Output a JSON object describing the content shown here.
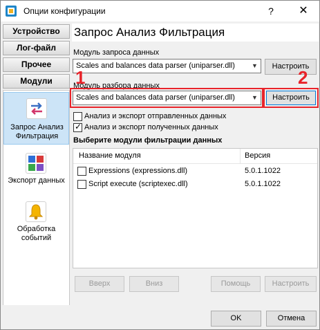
{
  "window": {
    "title": "Опции конфигурации",
    "help_glyph": "?",
    "close_glyph": "✕"
  },
  "nav": {
    "buttons": [
      {
        "label": "Устройство"
      },
      {
        "label": "Лог-файл"
      },
      {
        "label": "Прочее"
      },
      {
        "label": "Модули"
      }
    ],
    "tiles": [
      {
        "label_line1": "Запрос Анализ",
        "label_line2": "Фильтрация",
        "icon": "arrows-exchange-icon",
        "selected": true
      },
      {
        "label_line1": "Экспорт данных",
        "label_line2": "",
        "icon": "export-grid-icon",
        "selected": false
      },
      {
        "label_line1": "Обработка",
        "label_line2": "событий",
        "icon": "bell-icon",
        "selected": false
      }
    ]
  },
  "main": {
    "header": "Запрос Анализ Фильтрация",
    "request_module_label": "Модуль запроса данных",
    "request_module_value": "Scales and balances data parser (uniparser.dll)",
    "parser_module_label": "Модуль разбора данных",
    "parser_module_value": "Scales and balances data parser (uniparser.dll)",
    "configure_label": "Настроить",
    "check_sent": {
      "label": "Анализ и экспорт отправленных данных",
      "checked": false
    },
    "check_received": {
      "label": "Анализ и экспорт полученных данных",
      "checked": true
    },
    "filter_section_title": "Выберите модули фильтрации данных",
    "filter_table": {
      "columns": [
        "Название модуля",
        "Версия"
      ],
      "rows": [
        {
          "name": "Expressions (expressions.dll)",
          "version": "5.0.1.1022",
          "checked": false
        },
        {
          "name": "Script execute (scriptexec.dll)",
          "version": "5.0.1.1022",
          "checked": false
        }
      ]
    },
    "buttons": {
      "up": "Вверх",
      "down": "Вниз",
      "help": "Помощь",
      "configure": "Настроить"
    }
  },
  "annotations": {
    "marker1": "1",
    "marker2": "2",
    "color": "#e8232a"
  },
  "footer": {
    "ok": "OK",
    "cancel": "Отмена"
  }
}
